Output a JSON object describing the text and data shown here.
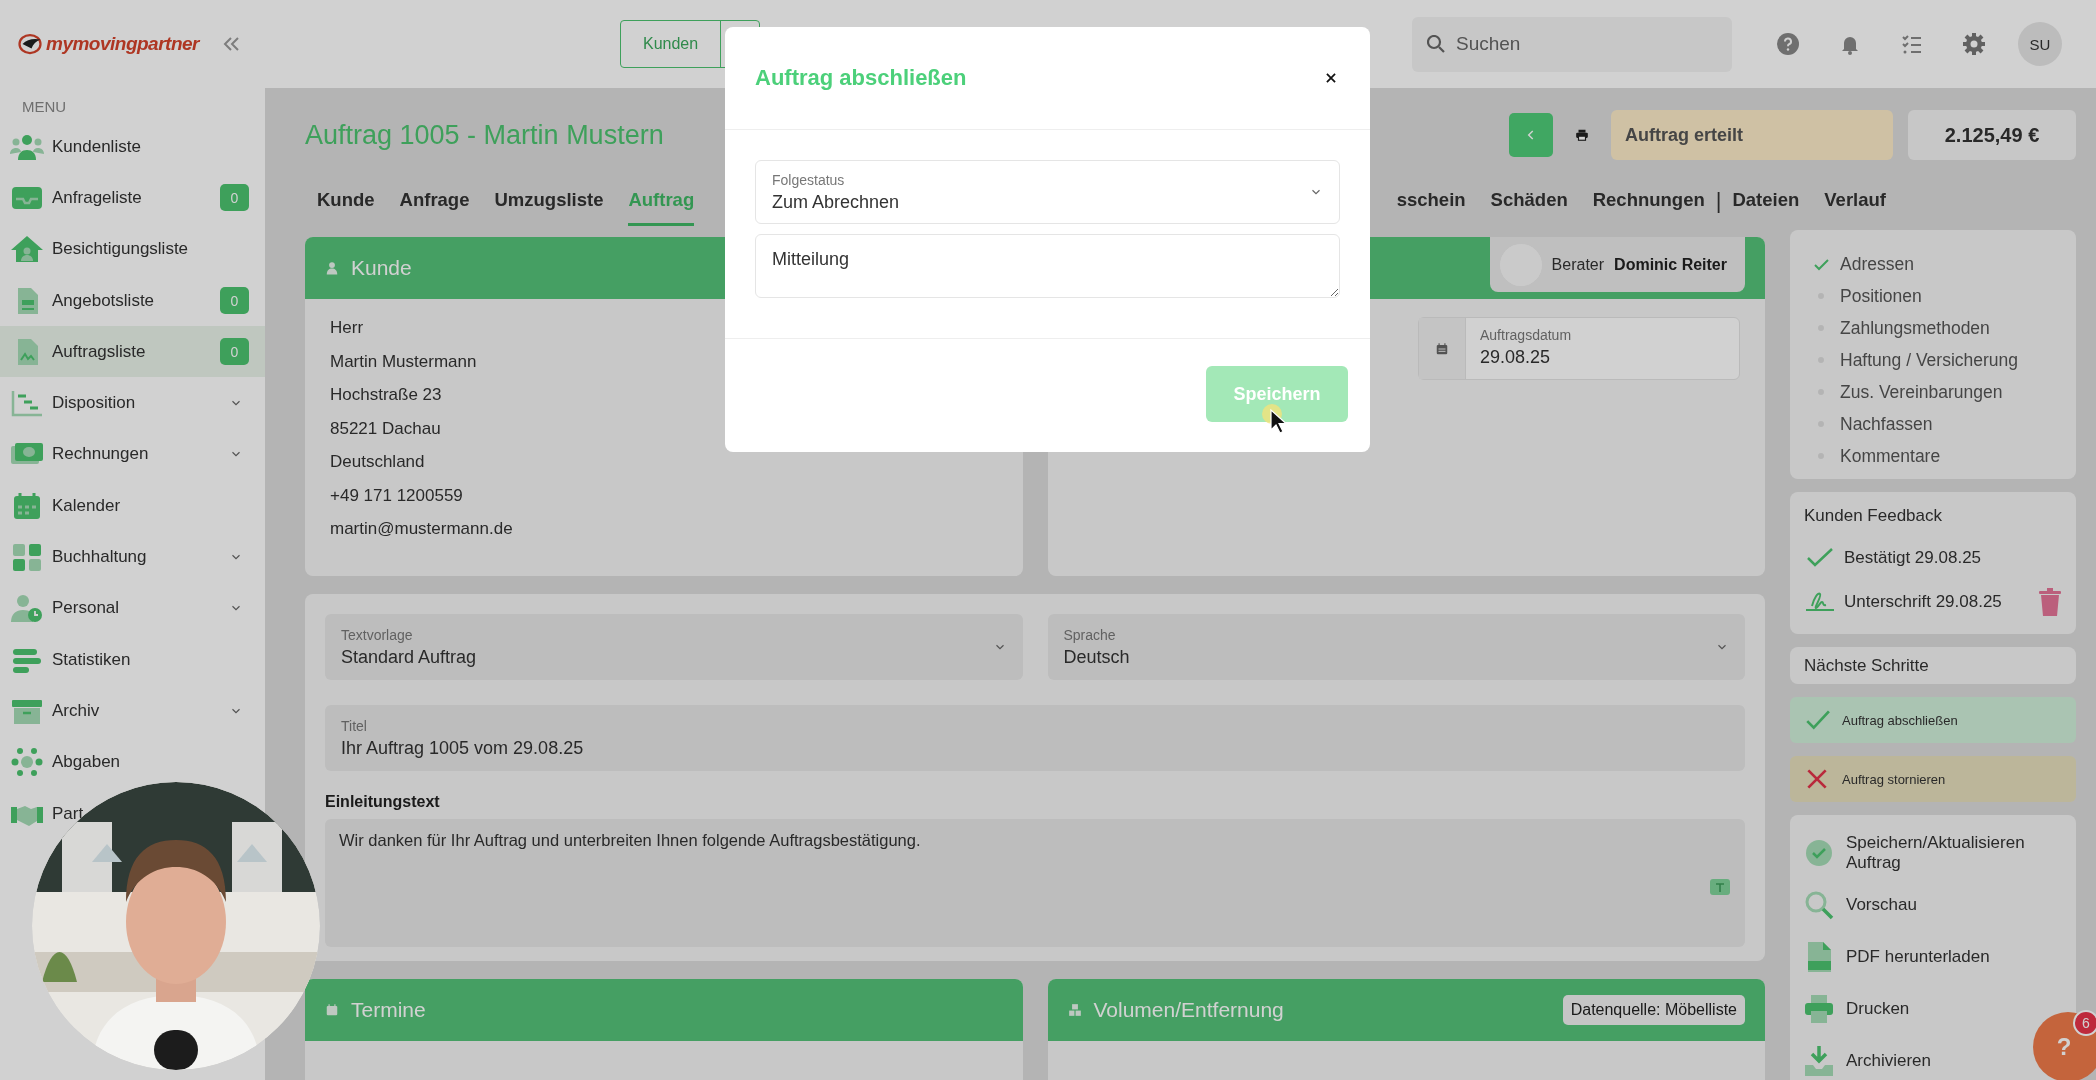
{
  "brand": {
    "logo": "mymovingpartner"
  },
  "sidebar": {
    "heading": "MENU",
    "items": [
      {
        "label": "Kundenliste",
        "selected": false,
        "expandable": false
      },
      {
        "label": "Anfrageliste",
        "badge": "0",
        "selected": false,
        "expandable": false
      },
      {
        "label": "Besichtigungsliste",
        "selected": false,
        "expandable": false
      },
      {
        "label": "Angebotsliste",
        "badge": "0",
        "selected": false,
        "expandable": false
      },
      {
        "label": "Auftragsliste",
        "badge": "0",
        "selected": true,
        "expandable": false
      },
      {
        "label": "Disposition",
        "selected": false,
        "expandable": true
      },
      {
        "label": "Rechnungen",
        "selected": false,
        "expandable": true
      },
      {
        "label": "Kalender",
        "selected": false,
        "expandable": false
      },
      {
        "label": "Buchhaltung",
        "selected": false,
        "expandable": true
      },
      {
        "label": "Personal",
        "selected": false,
        "expandable": true
      },
      {
        "label": "Statistiken",
        "selected": false,
        "expandable": false
      },
      {
        "label": "Archiv",
        "selected": false,
        "expandable": true
      },
      {
        "label": "Abgaben",
        "selected": false,
        "expandable": false
      },
      {
        "label": "Part",
        "selected": false,
        "expandable": false
      }
    ]
  },
  "topbar": {
    "quick_button": "Kunden",
    "search": {
      "placeholder": "Suchen"
    },
    "avatar": "SU"
  },
  "header": {
    "title": "Auftrag 1005 - Martin Mustern",
    "status": "Auftrag erteilt",
    "total": "2.125,49 €"
  },
  "tabs_left": [
    {
      "kind": "tab",
      "label": "Kunde",
      "selected": false
    },
    {
      "kind": "tab",
      "label": "Anfrage",
      "selected": false
    },
    {
      "kind": "tab",
      "label": "Umzugsliste",
      "selected": false
    },
    {
      "kind": "tab",
      "label": "Auftrag",
      "selected": true
    }
  ],
  "tabs_right": [
    {
      "kind": "tab",
      "label": "sschein",
      "selected": false
    },
    {
      "kind": "tab",
      "label": "Schäden",
      "selected": false
    },
    {
      "kind": "tab",
      "label": "Rechnungen",
      "selected": false
    },
    {
      "kind": "separator",
      "label": "|"
    },
    {
      "kind": "tab",
      "label": "Dateien",
      "selected": false
    },
    {
      "kind": "tab",
      "label": "Verlauf",
      "selected": false
    }
  ],
  "customer_card": {
    "title": "Kunde",
    "lines": [
      "Herr",
      "Martin Mustermann",
      "Hochstraße 23",
      "85221 Dachau",
      "Deutschland",
      "+49 171 1200559",
      "martin@mustermann.de"
    ]
  },
  "order_card": {
    "advisor_label": "Berater",
    "advisor_name": "Dominic Reiter",
    "date_field": {
      "label": "Auftragsdatum",
      "value": "29.08.25"
    }
  },
  "text_card": {
    "template": {
      "label": "Textvorlage",
      "value": "Standard Auftrag"
    },
    "language": {
      "label": "Sprache",
      "value": "Deutsch"
    },
    "title_field": {
      "label": "Titel",
      "value": "Ihr Auftrag 1005 vom 29.08.25"
    },
    "intro_label": "Einleitungstext",
    "intro_text": "Wir danken für Ihr Auftrag und unterbreiten Ihnen folgende Auftragsbestätigung."
  },
  "bottom_cards": [
    {
      "title": "Termine"
    },
    {
      "title": "Volumen/Entfernung",
      "badge": "Datenquelle: Möbelliste"
    }
  ],
  "checklist": [
    {
      "label": "Adressen",
      "done": true
    },
    {
      "label": "Positionen",
      "done": false
    },
    {
      "label": "Zahlungsmethoden",
      "done": false
    },
    {
      "label": "Haftung / Versicherung",
      "done": false
    },
    {
      "label": "Zus. Vereinbarungen",
      "done": false
    },
    {
      "label": "Nachfassen",
      "done": false
    },
    {
      "label": "Kommentare",
      "done": false
    }
  ],
  "feedback": {
    "title": "Kunden Feedback",
    "items": [
      {
        "kind": "confirmed",
        "label": "Bestätigt 29.08.25",
        "deletable": false
      },
      {
        "kind": "signature",
        "label": "Unterschrift 29.08.25",
        "deletable": true
      }
    ]
  },
  "next_steps": {
    "title": "Nächste Schritte",
    "items": [
      {
        "kind": "complete",
        "label": "Auftrag abschließen"
      },
      {
        "kind": "cancel",
        "label": "Auftrag stornieren"
      }
    ]
  },
  "actions": [
    {
      "label": "Speichern/Aktualisieren Auftrag"
    },
    {
      "label": "Vorschau"
    },
    {
      "label": "PDF herunterladen"
    },
    {
      "label": "Drucken"
    },
    {
      "label": "Archivieren"
    }
  ],
  "help": {
    "label": "?",
    "count": "6"
  },
  "dialog": {
    "title": "Auftrag abschließen",
    "status_field": {
      "label": "Folgestatus",
      "value": "Zum Abrechnen"
    },
    "message": {
      "placeholder": "Mitteilung"
    },
    "save": {
      "label": "Speichern",
      "disabled": true
    }
  }
}
